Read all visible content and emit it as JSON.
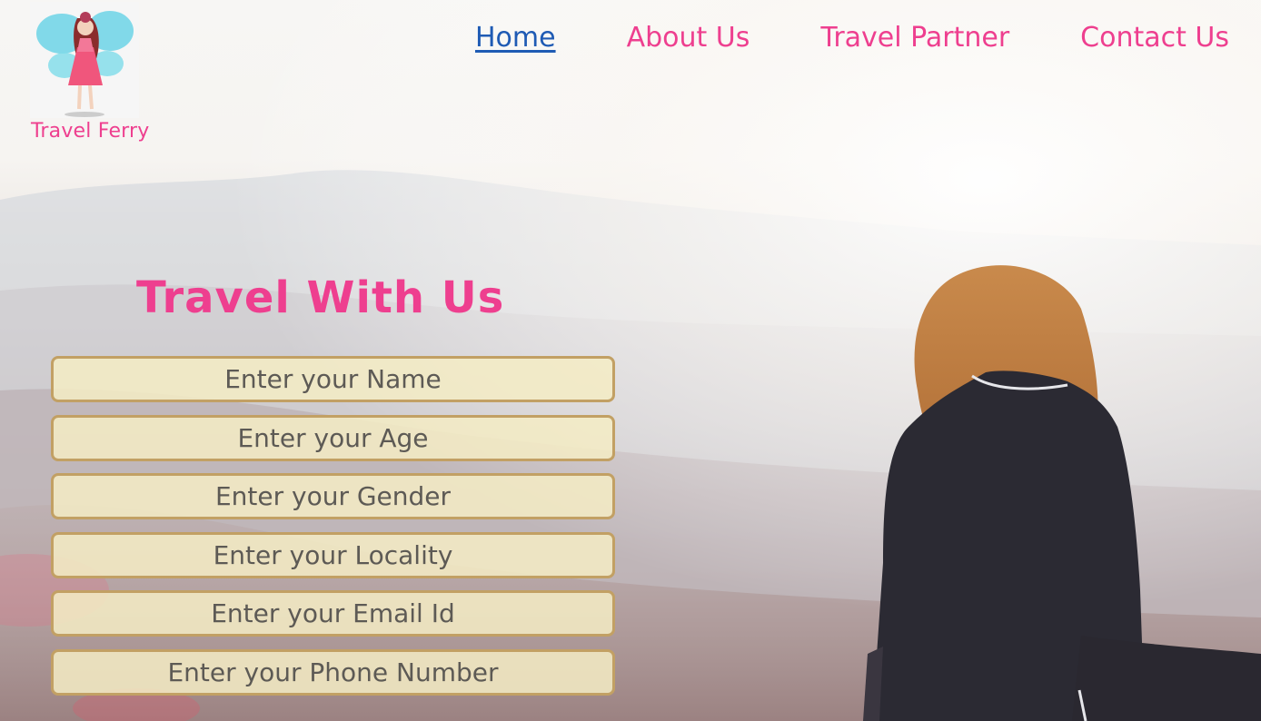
{
  "brand": {
    "name": "Travel Ferry",
    "logo_icon": "fairy-logo-icon"
  },
  "nav": {
    "items": [
      {
        "label": "Home",
        "active": true
      },
      {
        "label": "About Us",
        "active": false
      },
      {
        "label": "Travel Partner",
        "active": false
      },
      {
        "label": "Contact Us",
        "active": false
      }
    ]
  },
  "hero": {
    "title": "Travel With Us",
    "background": "woman-sitting-facing-misty-mountains-photo"
  },
  "form": {
    "fields": [
      {
        "placeholder": "Enter your Name"
      },
      {
        "placeholder": "Enter your Age"
      },
      {
        "placeholder": "Enter your Gender"
      },
      {
        "placeholder": "Enter your Locality"
      },
      {
        "placeholder": "Enter your Email Id"
      },
      {
        "placeholder": "Enter your Phone Number"
      }
    ]
  },
  "colors": {
    "accent": "#ee3f8f",
    "active_link": "#1f5bb4",
    "input_bg": "#f5ecc4",
    "input_border": "#c2a064"
  }
}
